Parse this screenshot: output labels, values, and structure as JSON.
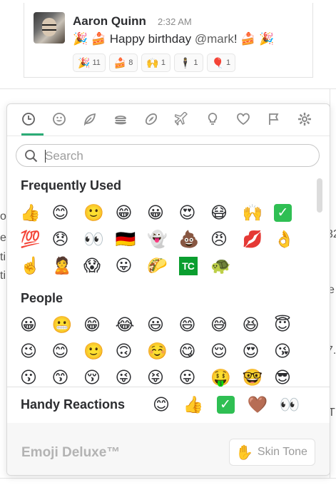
{
  "message": {
    "author": "Aaron Quinn",
    "time": "2:32 AM",
    "text_prefix": "🎉 🍰 Happy birthday ",
    "mention": "@mark",
    "text_suffix": "! 🍰 🎉",
    "reactions": [
      {
        "icon": "🎉",
        "count": "11"
      },
      {
        "icon": "🍰",
        "count": "8"
      },
      {
        "icon": "🙌",
        "count": "1"
      },
      {
        "icon": "🕴",
        "count": "1"
      },
      {
        "icon": "🎈",
        "count": "1"
      }
    ]
  },
  "picker": {
    "tabs": [
      {
        "name": "tab-recent",
        "icon": "clock-icon"
      },
      {
        "name": "tab-people",
        "icon": "smiley-icon"
      },
      {
        "name": "tab-nature",
        "icon": "leaf-icon"
      },
      {
        "name": "tab-food",
        "icon": "burger-icon"
      },
      {
        "name": "tab-activity",
        "icon": "football-icon"
      },
      {
        "name": "tab-travel",
        "icon": "airplane-icon"
      },
      {
        "name": "tab-objects",
        "icon": "lightbulb-icon"
      },
      {
        "name": "tab-symbols",
        "icon": "heart-icon"
      },
      {
        "name": "tab-flags",
        "icon": "flag-icon"
      },
      {
        "name": "tab-custom",
        "icon": "gear-icon"
      }
    ],
    "search_placeholder": "Search",
    "frequently_used_title": "Frequently Used",
    "frequently_used": [
      "👍",
      "😊",
      "🙂",
      "😁",
      "😀",
      "😍",
      "😷",
      "🙌",
      "✅",
      "💯",
      "😞",
      "👀",
      "🇩🇪",
      "👻",
      "💩",
      "😠",
      "💋",
      "👌",
      "☝️",
      "🙎",
      "😱",
      "😛",
      "🌮",
      "TC",
      "🐢"
    ],
    "people_title": "People",
    "people": [
      "😀",
      "😬",
      "😁",
      "😂",
      "😃",
      "😄",
      "😅",
      "😆",
      "😇",
      "😉",
      "😊",
      "🙂",
      "🙃",
      "☺️",
      "😋",
      "😌",
      "😍",
      "😘",
      "😗",
      "😙",
      "😚",
      "😜",
      "😝",
      "😛",
      "🤑",
      "🤓",
      "😎"
    ]
  },
  "handy": {
    "label": "Handy Reactions",
    "emojis": [
      "😊",
      "👍",
      "✅",
      "🤎",
      "👀"
    ]
  },
  "footer": {
    "brand": "Emoji Deluxe™",
    "skin_icon": "✋",
    "skin_label": "Skin Tone"
  },
  "edge_chars": [
    "o",
    "e",
    "ti",
    "ti",
    "32",
    "e",
    "7.",
    "T"
  ]
}
